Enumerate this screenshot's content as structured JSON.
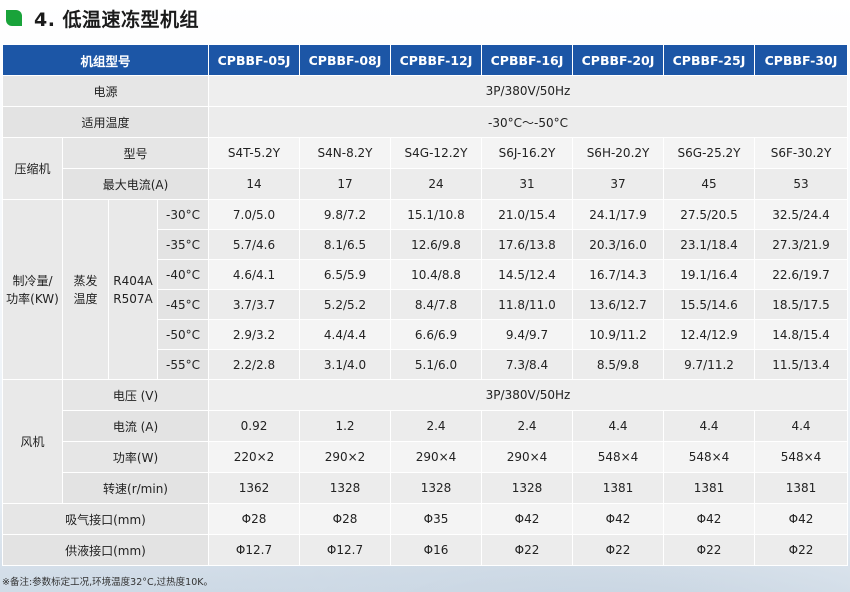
{
  "title": "4. 低温速冻型机组",
  "header": {
    "label": "机组型号",
    "models": [
      "CPBBF-05J",
      "CPBBF-08J",
      "CPBBF-12J",
      "CPBBF-16J",
      "CPBBF-20J",
      "CPBBF-25J",
      "CPBBF-30J"
    ]
  },
  "power": {
    "label": "电源",
    "value": "3P/380V/50Hz"
  },
  "temp_range": {
    "label": "适用温度",
    "value": "-30°C～-50°C"
  },
  "compressor": {
    "group": "压缩机",
    "model_label": "型号",
    "models": [
      "S4T-5.2Y",
      "S4N-8.2Y",
      "S4G-12.2Y",
      "S6J-16.2Y",
      "S6H-20.2Y",
      "S6G-25.2Y",
      "S6F-30.2Y"
    ],
    "current_label": "最大电流(A)",
    "currents": [
      "14",
      "17",
      "24",
      "31",
      "37",
      "45",
      "53"
    ]
  },
  "cooling": {
    "group_line1": "制冷量/",
    "group_line2": "功率(KW)",
    "evap_line1": "蒸发",
    "evap_line2": "温度",
    "refrig_line1": "R404A",
    "refrig_line2": "R507A",
    "rows": [
      {
        "temp": "-30°C",
        "values": [
          "7.0/5.0",
          "9.8/7.2",
          "15.1/10.8",
          "21.0/15.4",
          "24.1/17.9",
          "27.5/20.5",
          "32.5/24.4"
        ]
      },
      {
        "temp": "-35°C",
        "values": [
          "5.7/4.6",
          "8.1/6.5",
          "12.6/9.8",
          "17.6/13.8",
          "20.3/16.0",
          "23.1/18.4",
          "27.3/21.9"
        ]
      },
      {
        "temp": "-40°C",
        "values": [
          "4.6/4.1",
          "6.5/5.9",
          "10.4/8.8",
          "14.5/12.4",
          "16.7/14.3",
          "19.1/16.4",
          "22.6/19.7"
        ]
      },
      {
        "temp": "-45°C",
        "values": [
          "3.7/3.7",
          "5.2/5.2",
          "8.4/7.8",
          "11.8/11.0",
          "13.6/12.7",
          "15.5/14.6",
          "18.5/17.5"
        ]
      },
      {
        "temp": "-50°C",
        "values": [
          "2.9/3.2",
          "4.4/4.4",
          "6.6/6.9",
          "9.4/9.7",
          "10.9/11.2",
          "12.4/12.9",
          "14.8/15.4"
        ]
      },
      {
        "temp": "-55°C",
        "values": [
          "2.2/2.8",
          "3.1/4.0",
          "5.1/6.0",
          "7.3/8.4",
          "8.5/9.8",
          "9.7/11.2",
          "11.5/13.4"
        ]
      }
    ]
  },
  "fan": {
    "group": "风机",
    "voltage_label": "电压 (V)",
    "voltage": "3P/380V/50Hz",
    "current_label": "电流 (A)",
    "currents": [
      "0.92",
      "1.2",
      "2.4",
      "2.4",
      "4.4",
      "4.4",
      "4.4"
    ],
    "power_label": "功率(W)",
    "powers": [
      "220×2",
      "290×2",
      "290×4",
      "290×4",
      "548×4",
      "548×4",
      "548×4"
    ],
    "speed_label": "转速(r/min)",
    "speeds": [
      "1362",
      "1328",
      "1328",
      "1328",
      "1381",
      "1381",
      "1381"
    ]
  },
  "suction": {
    "label": "吸气接口(mm)",
    "values": [
      "Φ28",
      "Φ28",
      "Φ35",
      "Φ42",
      "Φ42",
      "Φ42",
      "Φ42"
    ]
  },
  "liquid": {
    "label": "供液接口(mm)",
    "values": [
      "Φ12.7",
      "Φ12.7",
      "Φ16",
      "Φ22",
      "Φ22",
      "Φ22",
      "Φ22"
    ]
  },
  "footnote": "※备注:参数标定工况,环境温度32°C,过热度10K。"
}
